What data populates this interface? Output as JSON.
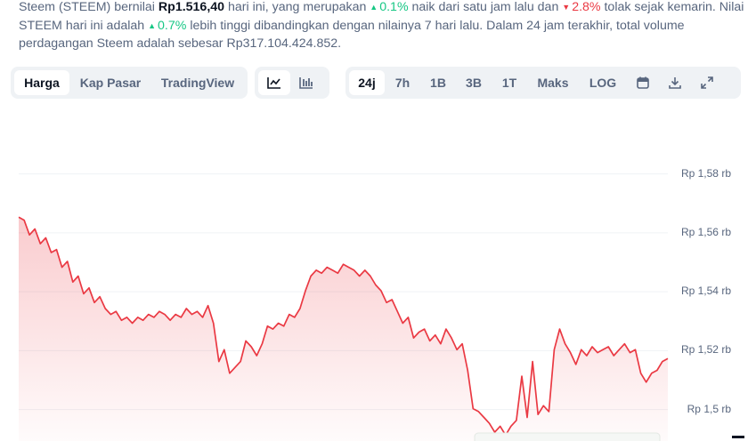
{
  "summary": {
    "p1": "Steem (STEEM) bernilai ",
    "price": "Rp1.516,40",
    "p2": " hari ini, yang merupakan ",
    "hour_change": "0.1%",
    "p3": " naik dari satu jam lalu dan ",
    "day_change": "2.8%",
    "p4": " tolak sejak kemarin. Nilai STEEM hari ini adalah ",
    "week_change": "0.7%",
    "p5": " lebih tinggi dibandingkan dengan nilainya 7 hari lalu. Dalam 24 jam terakhir, total volume perdagangan Steem adalah sebesar Rp317.104.424.852."
  },
  "view_tabs": [
    "Harga",
    "Kap Pasar",
    "TradingView"
  ],
  "active_view": "Harga",
  "chart_type_icons": [
    "line-chart-icon",
    "candlestick-chart-icon"
  ],
  "range_tabs": [
    "24j",
    "7h",
    "1B",
    "3B",
    "1T",
    "Maks",
    "LOG"
  ],
  "active_range": "24j",
  "tool_icons": [
    "calendar-icon",
    "download-icon",
    "expand-icon"
  ],
  "colors": {
    "line": "#ea3943",
    "up": "#16c784",
    "down": "#ea3943",
    "text": "#58667e",
    "accent": "#0d1421"
  },
  "chart_data": {
    "type": "area",
    "y_tick_labels": [
      "Rp 1,58 rb",
      "Rp 1,56 rb",
      "Rp 1,54 rb",
      "Rp 1,52 rb",
      "Rp 1,5 rb"
    ],
    "y_ticks": [
      1580,
      1560,
      1540,
      1520,
      1500
    ],
    "ylim": [
      1489,
      1598
    ],
    "grid": true,
    "values": [
      1565,
      1564,
      1559,
      1561,
      1556,
      1558,
      1553,
      1554,
      1548,
      1550,
      1543,
      1545,
      1539,
      1541,
      1536,
      1538,
      1534,
      1532,
      1533,
      1530,
      1531,
      1529,
      1531,
      1530,
      1532,
      1531,
      1533,
      1532,
      1530,
      1532,
      1531,
      1534,
      1532,
      1533,
      1531,
      1535,
      1529,
      1516,
      1520,
      1512,
      1514,
      1516,
      1523,
      1521,
      1518,
      1522,
      1528,
      1527,
      1529,
      1528,
      1532,
      1531,
      1534,
      1540,
      1545,
      1547,
      1546,
      1548,
      1547,
      1546,
      1549,
      1548,
      1547,
      1545,
      1547,
      1545,
      1542,
      1540,
      1536,
      1537,
      1533,
      1529,
      1531,
      1524,
      1526,
      1527,
      1523,
      1525,
      1522,
      1527,
      1524,
      1520,
      1522,
      1513,
      1500,
      1499,
      1497,
      1495,
      1492,
      1494,
      1491,
      1494,
      1496,
      1511,
      1497,
      1516,
      1498,
      1501,
      1499,
      1520,
      1527,
      1522,
      1519,
      1515,
      1520,
      1518,
      1521,
      1519,
      1520,
      1521,
      1518,
      1520,
      1522,
      1519,
      1520,
      1512,
      1509,
      1512,
      1513,
      1516,
      1517
    ]
  }
}
